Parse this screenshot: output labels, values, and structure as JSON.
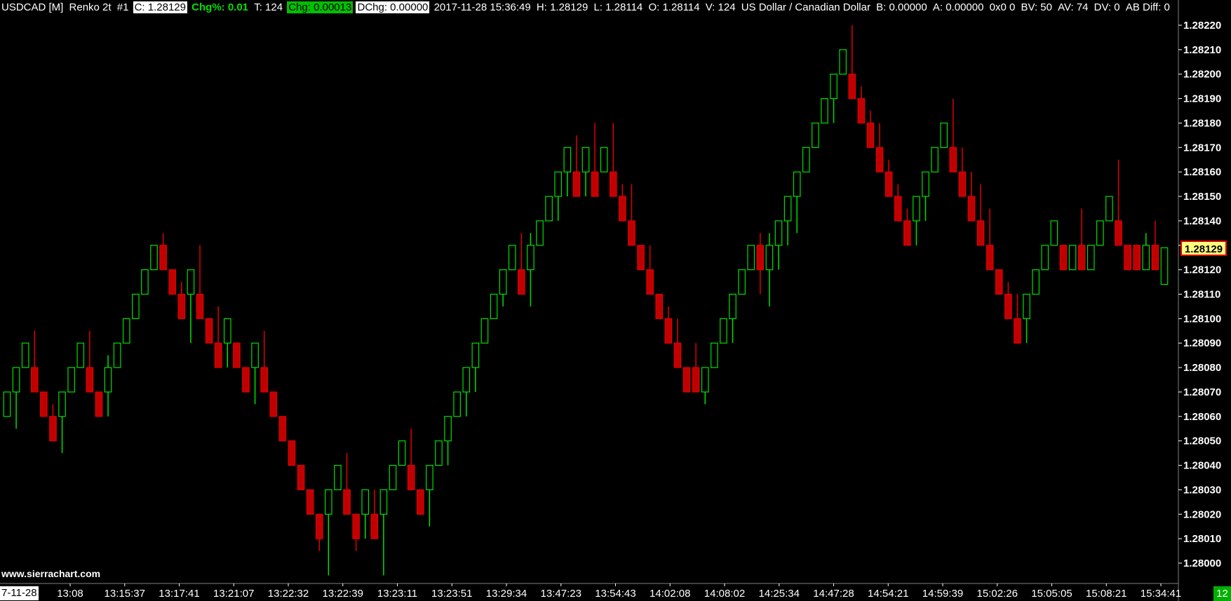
{
  "header": {
    "symbol": "USDCAD [M]",
    "chart_type": "Renko 2t",
    "chart_number": "#1",
    "close": "C: 1.28129",
    "chg_pct": "Chg%: 0.01",
    "ticks": "T: 124",
    "chg": "Chg: 0.00013",
    "dchg": "DChg: 0.00000",
    "timestamp": "2017-11-28 15:36:49",
    "high": "H: 1.28129",
    "low": "L: 1.28114",
    "open": "O: 1.28114",
    "volume": "V: 124",
    "description": "US Dollar / Canadian Dollar",
    "bid": "B: 0.00000",
    "ask": "A: 0.00000",
    "bid_ask_size": "0x0 0",
    "bid_volume": "BV: 50",
    "ask_volume": "AV: 74",
    "delta_volume": "DV: 0",
    "ab_diff": "AB Diff: 0"
  },
  "watermark": "www.sierrachart.com",
  "date_label": "7-11-28",
  "current_price_label": "1.28129",
  "bar_count_label": "12",
  "colors": {
    "up": "#00e000",
    "down": "#e00000",
    "down_body": "#c00000",
    "background": "#000000"
  },
  "chart_data": {
    "type": "candlestick",
    "y_axis_ticks": [
      "1.28220",
      "1.28210",
      "1.28200",
      "1.28190",
      "1.28180",
      "1.28170",
      "1.28160",
      "1.28150",
      "1.28140",
      "1.28130",
      "1.28120",
      "1.28110",
      "1.28100",
      "1.28090",
      "1.28080",
      "1.28070",
      "1.28060",
      "1.28050",
      "1.28040",
      "1.28030",
      "1.28020",
      "1.28010",
      "1.28000"
    ],
    "x_axis_labels": [
      "13:08",
      "13:15:37",
      "13:17:41",
      "13:21:07",
      "13:22:32",
      "13:22:39",
      "13:23:11",
      "13:23:51",
      "13:29:34",
      "13:47:23",
      "13:54:43",
      "14:02:08",
      "14:08:02",
      "14:25:34",
      "14:47:28",
      "14:54:21",
      "14:59:39",
      "15:02:26",
      "15:05:05",
      "15:08:21",
      "15:34:41"
    ],
    "ylim": [
      1.27995,
      1.28225
    ],
    "bars": [
      [
        "u",
        1.2806,
        1.2807,
        1.2807,
        1.2806
      ],
      [
        "u",
        1.2807,
        1.2808,
        1.2808,
        1.28055
      ],
      [
        "u",
        1.2808,
        1.2809,
        1.2809,
        1.2808
      ],
      [
        "d",
        1.2808,
        1.2807,
        1.28095,
        1.2807
      ],
      [
        "d",
        1.2807,
        1.2806,
        1.2807,
        1.2806
      ],
      [
        "d",
        1.2806,
        1.2805,
        1.28065,
        1.2805
      ],
      [
        "u",
        1.2806,
        1.2807,
        1.2807,
        1.28045
      ],
      [
        "u",
        1.2807,
        1.2808,
        1.2808,
        1.2807
      ],
      [
        "u",
        1.2808,
        1.2809,
        1.2809,
        1.2808
      ],
      [
        "d",
        1.2808,
        1.2807,
        1.28095,
        1.2807
      ],
      [
        "d",
        1.2807,
        1.2806,
        1.2807,
        1.2806
      ],
      [
        "u",
        1.2807,
        1.2808,
        1.28085,
        1.2806
      ],
      [
        "u",
        1.2808,
        1.2809,
        1.2809,
        1.2808
      ],
      [
        "u",
        1.2809,
        1.281,
        1.281,
        1.2809
      ],
      [
        "u",
        1.281,
        1.2811,
        1.2811,
        1.281
      ],
      [
        "u",
        1.2811,
        1.2812,
        1.2812,
        1.2811
      ],
      [
        "u",
        1.2812,
        1.2813,
        1.2813,
        1.2812
      ],
      [
        "d",
        1.2813,
        1.2812,
        1.28135,
        1.2812
      ],
      [
        "d",
        1.2812,
        1.2811,
        1.2812,
        1.2811
      ],
      [
        "d",
        1.2811,
        1.281,
        1.28115,
        1.281
      ],
      [
        "u",
        1.2811,
        1.2812,
        1.2812,
        1.2809
      ],
      [
        "d",
        1.2811,
        1.281,
        1.2813,
        1.281
      ],
      [
        "d",
        1.281,
        1.2809,
        1.281,
        1.2809
      ],
      [
        "d",
        1.2809,
        1.2808,
        1.28105,
        1.2808
      ],
      [
        "u",
        1.2809,
        1.281,
        1.281,
        1.2808
      ],
      [
        "d",
        1.2809,
        1.2808,
        1.2809,
        1.2808
      ],
      [
        "d",
        1.2808,
        1.2807,
        1.2808,
        1.2807
      ],
      [
        "u",
        1.2808,
        1.2809,
        1.2809,
        1.28065
      ],
      [
        "d",
        1.2808,
        1.2807,
        1.28095,
        1.2807
      ],
      [
        "d",
        1.2807,
        1.2806,
        1.2807,
        1.2806
      ],
      [
        "d",
        1.2806,
        1.2805,
        1.2806,
        1.2805
      ],
      [
        "d",
        1.2805,
        1.2804,
        1.2805,
        1.2804
      ],
      [
        "d",
        1.2804,
        1.2803,
        1.2804,
        1.2803
      ],
      [
        "d",
        1.2803,
        1.2802,
        1.2803,
        1.2802
      ],
      [
        "d",
        1.2802,
        1.2801,
        1.2802,
        1.28005
      ],
      [
        "u",
        1.2802,
        1.2803,
        1.2803,
        1.27995
      ],
      [
        "u",
        1.2803,
        1.2804,
        1.2804,
        1.2803
      ],
      [
        "d",
        1.2803,
        1.2802,
        1.28045,
        1.2802
      ],
      [
        "d",
        1.2802,
        1.2801,
        1.2802,
        1.28005
      ],
      [
        "u",
        1.2802,
        1.2803,
        1.2803,
        1.2801
      ],
      [
        "d",
        1.2802,
        1.2801,
        1.2803,
        1.2801
      ],
      [
        "u",
        1.2802,
        1.2803,
        1.2803,
        1.27995
      ],
      [
        "u",
        1.2803,
        1.2804,
        1.2804,
        1.2803
      ],
      [
        "u",
        1.2804,
        1.2805,
        1.2805,
        1.2804
      ],
      [
        "d",
        1.2804,
        1.2803,
        1.28055,
        1.2803
      ],
      [
        "d",
        1.2803,
        1.2802,
        1.2803,
        1.2802
      ],
      [
        "u",
        1.2803,
        1.2804,
        1.2804,
        1.28015
      ],
      [
        "u",
        1.2804,
        1.2805,
        1.2805,
        1.2804
      ],
      [
        "u",
        1.2805,
        1.2806,
        1.2806,
        1.2804
      ],
      [
        "u",
        1.2806,
        1.2807,
        1.2807,
        1.2806
      ],
      [
        "u",
        1.2807,
        1.2808,
        1.2808,
        1.2806
      ],
      [
        "u",
        1.2808,
        1.2809,
        1.2809,
        1.2807
      ],
      [
        "u",
        1.2809,
        1.281,
        1.281,
        1.2809
      ],
      [
        "u",
        1.281,
        1.2811,
        1.2811,
        1.281
      ],
      [
        "u",
        1.2811,
        1.2812,
        1.2812,
        1.28105
      ],
      [
        "u",
        1.2812,
        1.2813,
        1.2813,
        1.2812
      ],
      [
        "d",
        1.2812,
        1.2811,
        1.28135,
        1.2811
      ],
      [
        "u",
        1.2812,
        1.2813,
        1.28135,
        1.28105
      ],
      [
        "u",
        1.2813,
        1.2814,
        1.2814,
        1.2813
      ],
      [
        "u",
        1.2814,
        1.2815,
        1.2815,
        1.2814
      ],
      [
        "u",
        1.2815,
        1.2816,
        1.2816,
        1.2814
      ],
      [
        "u",
        1.2816,
        1.2817,
        1.2817,
        1.2815
      ],
      [
        "d",
        1.2816,
        1.2815,
        1.28175,
        1.2815
      ],
      [
        "u",
        1.2816,
        1.2817,
        1.2817,
        1.2815
      ],
      [
        "d",
        1.2816,
        1.2815,
        1.2818,
        1.2815
      ],
      [
        "u",
        1.2816,
        1.2817,
        1.2817,
        1.2816
      ],
      [
        "d",
        1.2816,
        1.2815,
        1.2818,
        1.2815
      ],
      [
        "d",
        1.2815,
        1.2814,
        1.28155,
        1.2814
      ],
      [
        "d",
        1.2814,
        1.2813,
        1.28155,
        1.2813
      ],
      [
        "d",
        1.2813,
        1.2812,
        1.2813,
        1.2812
      ],
      [
        "d",
        1.2812,
        1.2811,
        1.2813,
        1.2811
      ],
      [
        "d",
        1.2811,
        1.281,
        1.2811,
        1.281
      ],
      [
        "d",
        1.281,
        1.2809,
        1.28105,
        1.2809
      ],
      [
        "d",
        1.2809,
        1.2808,
        1.281,
        1.2808
      ],
      [
        "d",
        1.2808,
        1.2807,
        1.2808,
        1.2807
      ],
      [
        "d",
        1.2808,
        1.2807,
        1.2809,
        1.2807
      ],
      [
        "u",
        1.2807,
        1.2808,
        1.2808,
        1.28065
      ],
      [
        "u",
        1.2808,
        1.2809,
        1.2809,
        1.2808
      ],
      [
        "u",
        1.2809,
        1.281,
        1.281,
        1.2809
      ],
      [
        "u",
        1.281,
        1.2811,
        1.2811,
        1.2809
      ],
      [
        "u",
        1.2811,
        1.2812,
        1.2812,
        1.2811
      ],
      [
        "u",
        1.2812,
        1.2813,
        1.2813,
        1.2812
      ],
      [
        "d",
        1.2813,
        1.2812,
        1.28135,
        1.2811
      ],
      [
        "u",
        1.2812,
        1.2813,
        1.28135,
        1.28105
      ],
      [
        "u",
        1.2813,
        1.2814,
        1.2814,
        1.2812
      ],
      [
        "u",
        1.2814,
        1.2815,
        1.2815,
        1.2813
      ],
      [
        "u",
        1.2815,
        1.2816,
        1.2816,
        1.28135
      ],
      [
        "u",
        1.2816,
        1.2817,
        1.2817,
        1.2816
      ],
      [
        "u",
        1.2817,
        1.2818,
        1.2818,
        1.2817
      ],
      [
        "u",
        1.2818,
        1.2819,
        1.2819,
        1.2818
      ],
      [
        "u",
        1.2819,
        1.282,
        1.282,
        1.2818
      ],
      [
        "u",
        1.282,
        1.2821,
        1.2821,
        1.282
      ],
      [
        "d",
        1.282,
        1.2819,
        1.2822,
        1.2819
      ],
      [
        "d",
        1.2819,
        1.2818,
        1.28195,
        1.2818
      ],
      [
        "d",
        1.2818,
        1.2817,
        1.28185,
        1.2817
      ],
      [
        "d",
        1.2817,
        1.2816,
        1.2818,
        1.2816
      ],
      [
        "d",
        1.2816,
        1.2815,
        1.28165,
        1.2815
      ],
      [
        "d",
        1.2815,
        1.2814,
        1.28155,
        1.2814
      ],
      [
        "d",
        1.2814,
        1.2813,
        1.28145,
        1.2813
      ],
      [
        "u",
        1.2814,
        1.2815,
        1.2815,
        1.2813
      ],
      [
        "u",
        1.2815,
        1.2816,
        1.2816,
        1.2814
      ],
      [
        "u",
        1.2816,
        1.2817,
        1.2817,
        1.2816
      ],
      [
        "u",
        1.2817,
        1.2818,
        1.2818,
        1.2817
      ],
      [
        "d",
        1.2817,
        1.2816,
        1.2819,
        1.2816
      ],
      [
        "d",
        1.2816,
        1.2815,
        1.2817,
        1.2815
      ],
      [
        "d",
        1.2815,
        1.2814,
        1.2816,
        1.2814
      ],
      [
        "d",
        1.2814,
        1.2813,
        1.28155,
        1.2813
      ],
      [
        "d",
        1.2813,
        1.2812,
        1.28145,
        1.2812
      ],
      [
        "d",
        1.2812,
        1.2811,
        1.2812,
        1.2811
      ],
      [
        "d",
        1.2811,
        1.281,
        1.28115,
        1.281
      ],
      [
        "d",
        1.281,
        1.2809,
        1.2811,
        1.2809
      ],
      [
        "u",
        1.281,
        1.2811,
        1.2811,
        1.2809
      ],
      [
        "u",
        1.2811,
        1.2812,
        1.2812,
        1.2811
      ],
      [
        "u",
        1.2812,
        1.2813,
        1.2813,
        1.2812
      ],
      [
        "u",
        1.2813,
        1.2814,
        1.2814,
        1.2813
      ],
      [
        "d",
        1.2813,
        1.2812,
        1.2813,
        1.2812
      ],
      [
        "u",
        1.2812,
        1.2813,
        1.2813,
        1.2812
      ],
      [
        "d",
        1.2813,
        1.2812,
        1.28145,
        1.2812
      ],
      [
        "u",
        1.2812,
        1.2813,
        1.2813,
        1.2812
      ],
      [
        "u",
        1.2813,
        1.2814,
        1.2814,
        1.2813
      ],
      [
        "u",
        1.2814,
        1.2815,
        1.2815,
        1.2814
      ],
      [
        "d",
        1.2814,
        1.2813,
        1.28165,
        1.2813
      ],
      [
        "d",
        1.2813,
        1.2812,
        1.2813,
        1.2812
      ],
      [
        "d",
        1.2813,
        1.2812,
        1.2813,
        1.2812
      ],
      [
        "u",
        1.2812,
        1.2813,
        1.28135,
        1.2812
      ],
      [
        "d",
        1.2813,
        1.2812,
        1.2814,
        1.2812
      ],
      [
        "u",
        1.28114,
        1.28129,
        1.28129,
        1.28114
      ]
    ]
  }
}
